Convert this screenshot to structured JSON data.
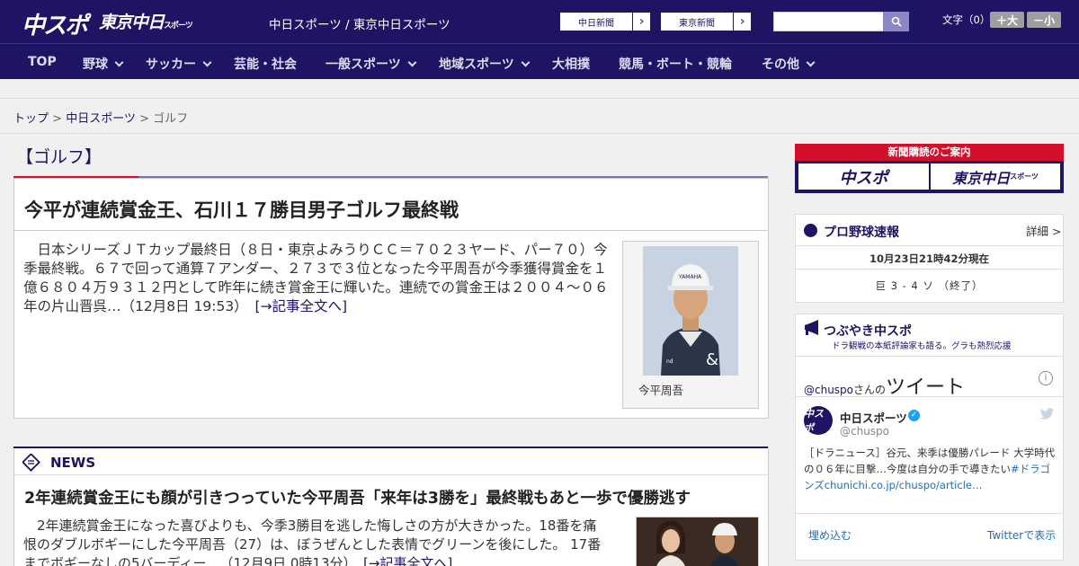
{
  "header": {
    "logo_chuspo": "中スポ",
    "logo_tokyo": "東京中日",
    "logo_tokyo_small": "スポーツ",
    "site_links": "中日スポーツ / 東京中日スポーツ",
    "ext_links": [
      {
        "label": "中日新聞",
        "arrow": "›"
      },
      {
        "label": "東京新聞",
        "arrow": "›"
      }
    ],
    "search_placeholder": "",
    "font_size_label": "文字（0）",
    "font_larger": "＋大",
    "font_smaller": "－小"
  },
  "nav": {
    "items": [
      {
        "label": "TOP"
      },
      {
        "label": "野球"
      },
      {
        "label": "サッカー"
      },
      {
        "label": "芸能・社会"
      },
      {
        "label": "一般スポーツ"
      },
      {
        "label": "地域スポーツ"
      },
      {
        "label": "大相撲"
      },
      {
        "label": "競馬・ボート・競輪"
      },
      {
        "label": "その他"
      }
    ]
  },
  "breadcrumb": {
    "top": "トップ",
    "sep1": " > ",
    "section": "中日スポーツ",
    "sep2": " > ",
    "current": "ゴルフ"
  },
  "section_title": "【ゴルフ】",
  "main_article": {
    "title": "今平が連続賞金王、石川１７勝目男子ゴルフ最終戦",
    "body": "日本シリーズＪＴカップ最終日（８日・東京よみうりＣＣ＝７０２３ヤード、パー７０）今季最終戦。６７で回って通算７アンダー、２７３で３位となった今平周吾が今季獲得賞金を１億６８０４万９３１２円として昨年に続き賞金王に輝いた。連続での賞金王は２００４～０６年の片山晋呉…（12月8日 19:53）",
    "read_more": "[→記事全文へ]",
    "photo_caption": "今平周吾"
  },
  "news": {
    "header": "NEWS",
    "title": "2年連続賞金王にも顔が引きつっていた今平周吾「来年は3勝を」最終戦もあと一歩で優勝逃す",
    "body": "2年連続賞金王になった喜びよりも、今季3勝目を逃した悔しさの方が大きかった。18番を痛恨のダブルボギーにした今平周吾（27）は、ぼうぜんとした表情でグリーンを後にした。 17番までボギーなしの5バーディー…（12月9日 0時13分）",
    "read_more": "[→記事全文へ]"
  },
  "sidebar": {
    "subscribe_title": "新聞購読のご案内",
    "subscribe_logo1": "中スポ",
    "subscribe_logo2": "東京中日",
    "subscribe_logo2_small": "スポーツ",
    "baseball": {
      "title": "プロ野球速報",
      "more": "詳細 >",
      "time": "10月23日21時42分現在",
      "score": "巨 3 - 4 ソ （終了）"
    },
    "twitter_widget": {
      "title": "つぶやき中スポ",
      "subtitle": "ドラ観戦の本紙評論家も語る。グラも熱烈応援",
      "handle": "@chuspo",
      "handle_suffix": "さんの",
      "tweets_label": "ツイート",
      "info": "i",
      "account_name": "中日スポーツ",
      "account_id": "@chuspo",
      "avatar_text": "中スポ",
      "tweet_text": "［ドラニュース］谷元、来季は優勝パレード 大学時代の０６年に目撃…今度は自分の手で導きたい",
      "tweet_tag": "#ドラゴンズchunichi.co.jp/chuspo/article…",
      "embed": "埋め込む",
      "view_on": "Twitterで表示"
    }
  },
  "colors": {
    "brand_navy": "#1e1463",
    "accent_red": "#d40f2b",
    "link_blue": "#1e6fb5"
  }
}
